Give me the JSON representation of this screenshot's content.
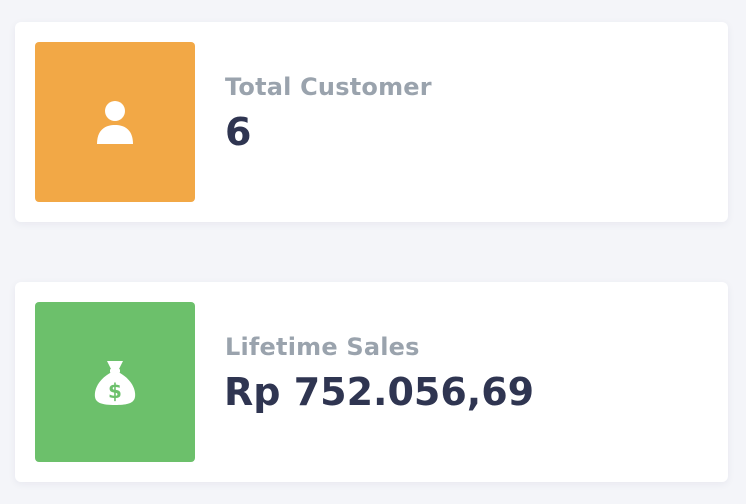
{
  "cards": [
    {
      "label": "Total Customer",
      "value": "6",
      "icon": "user-icon",
      "color": "#f2a846"
    },
    {
      "label": "Lifetime Sales",
      "value": "Rp 752.056,69",
      "icon": "money-bag-icon",
      "color": "#6cc06b"
    }
  ],
  "colors": {
    "background": "#f4f5f9",
    "card": "#ffffff",
    "label_text": "#9aa3ad",
    "value_text": "#2f3551"
  }
}
